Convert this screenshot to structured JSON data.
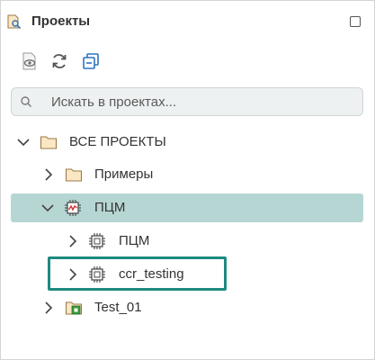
{
  "panel": {
    "title": "Проекты"
  },
  "toolbar": {
    "buttons": [
      "view-document-icon",
      "refresh-icon",
      "collapse-all-icon"
    ]
  },
  "search": {
    "placeholder": "Искать в проектах..."
  },
  "tree": {
    "items": [
      {
        "label": "ВСЕ ПРОЕКТЫ",
        "icon": "folder-icon",
        "expanded": true,
        "level": 0
      },
      {
        "label": "Примеры",
        "icon": "folder-icon",
        "expanded": false,
        "level": 1
      },
      {
        "label": "ПЦМ",
        "icon": "chip-signal-icon",
        "expanded": true,
        "level": 1,
        "selected": true
      },
      {
        "label": "ПЦМ",
        "icon": "chip-icon",
        "expanded": false,
        "level": 2
      },
      {
        "label": "ccr_testing",
        "icon": "chip-icon",
        "expanded": false,
        "level": 2,
        "highlighted": true
      },
      {
        "label": "Test_01",
        "icon": "green-folder-icon",
        "expanded": false,
        "level": 1
      }
    ]
  },
  "colors": {
    "selection": "#b6d6d4",
    "highlight_border": "#1e8a80",
    "folder_fill": "#fbe7c3",
    "folder_stroke": "#9a7a4a",
    "toolbar_blue": "#2f74c0",
    "test_green": "#3c9a3c"
  }
}
